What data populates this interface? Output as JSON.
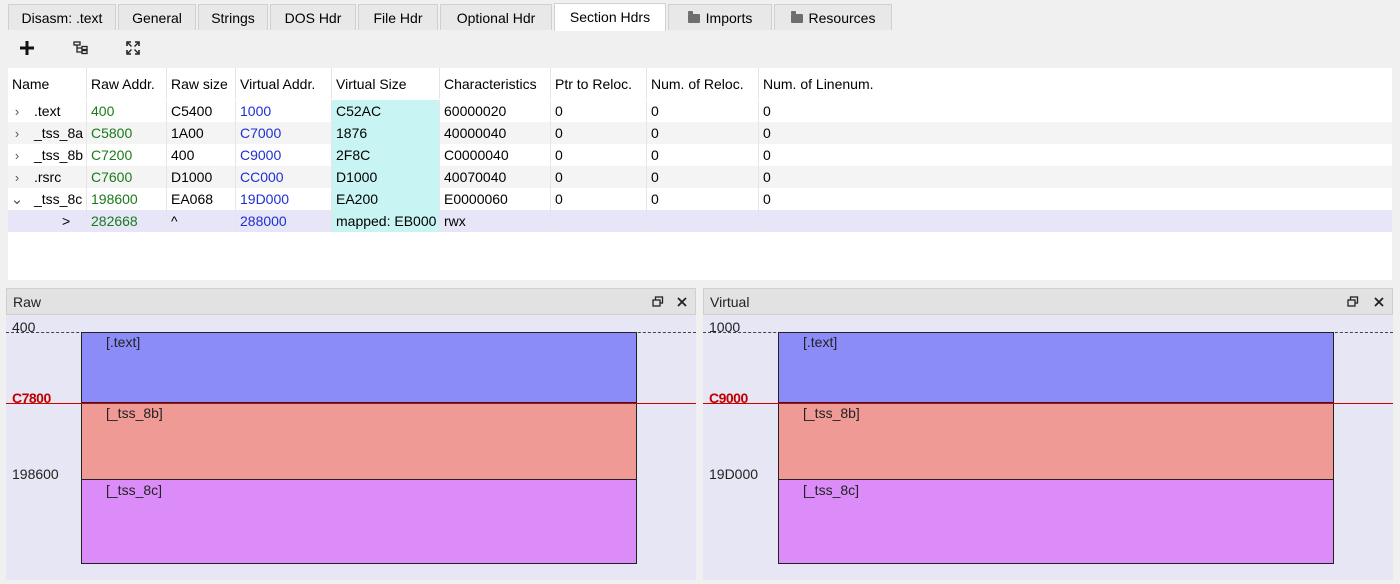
{
  "tabs": [
    {
      "label": "Disasm: .text"
    },
    {
      "label": "General"
    },
    {
      "label": "Strings"
    },
    {
      "label": "DOS Hdr"
    },
    {
      "label": "File Hdr"
    },
    {
      "label": "Optional Hdr"
    },
    {
      "label": "Section Hdrs",
      "active": true
    },
    {
      "label": "Imports",
      "icon": "folder-icon"
    },
    {
      "label": "Resources",
      "icon": "folder-icon"
    }
  ],
  "toolbar": {
    "add_icon": "plus-icon",
    "tree_icon": "tree-view-icon",
    "expand_icon": "fit-view-icon"
  },
  "table": {
    "columns": [
      "Name",
      "Raw Addr.",
      "Raw size",
      "Virtual Addr.",
      "Virtual Size",
      "Characteristics",
      "Ptr to Reloc.",
      "Num. of Reloc.",
      "Num. of Linenum."
    ],
    "rows": [
      {
        "arrow": "›",
        "name": ".text",
        "raw_addr": "400",
        "raw_size": "C5400",
        "virt_addr": "1000",
        "virt_size": "C52AC",
        "chars": "60000020",
        "ptr_reloc": "0",
        "num_reloc": "0",
        "num_line": "0"
      },
      {
        "arrow": "›",
        "name": "_tss_8a",
        "raw_addr": "C5800",
        "raw_size": "1A00",
        "virt_addr": "C7000",
        "virt_size": "1876",
        "chars": "40000040",
        "ptr_reloc": "0",
        "num_reloc": "0",
        "num_line": "0"
      },
      {
        "arrow": "›",
        "name": "_tss_8b",
        "raw_addr": "C7200",
        "raw_size": "400",
        "virt_addr": "C9000",
        "virt_size": "2F8C",
        "chars": "C0000040",
        "ptr_reloc": "0",
        "num_reloc": "0",
        "num_line": "0"
      },
      {
        "arrow": "›",
        "name": ".rsrc",
        "raw_addr": "C7600",
        "raw_size": "D1000",
        "virt_addr": "CC000",
        "virt_size": "D1000",
        "chars": "40070040",
        "ptr_reloc": "0",
        "num_reloc": "0",
        "num_line": "0"
      },
      {
        "arrow": "⌄",
        "name": "_tss_8c",
        "raw_addr": "198600",
        "raw_size": "EA068",
        "virt_addr": "19D000",
        "virt_size": "EA200",
        "chars": "E0000060",
        "ptr_reloc": "0",
        "num_reloc": "0",
        "num_line": "0"
      }
    ],
    "subrow": {
      "marker": ">",
      "raw_addr": "282668",
      "raw_size": "^",
      "virt_addr": "288000",
      "virt_size": "mapped: EB000",
      "chars": "rwx"
    }
  },
  "raw_panel": {
    "title": "Raw",
    "top_addr": "400",
    "mid_addr": "C7800",
    "low_addr": "198600",
    "blocks": [
      {
        "label": "[.text]",
        "color": "#8c8cf8"
      },
      {
        "label": "[_tss_8b]",
        "color": "#f09a96"
      },
      {
        "label": "[_tss_8c]",
        "color": "#dc8cf8"
      }
    ]
  },
  "virtual_panel": {
    "title": "Virtual",
    "top_addr": "1000",
    "mid_addr": "C9000",
    "low_addr": "19D000",
    "blocks": [
      {
        "label": "[.text]",
        "color": "#8c8cf8"
      },
      {
        "label": "[_tss_8b]",
        "color": "#f09a96"
      },
      {
        "label": "[_tss_8c]",
        "color": "#dc8cf8"
      }
    ]
  },
  "colors": {
    "raw_addr": "#1a7a1a",
    "virt_addr": "#1f2fd1",
    "virt_size_bg": "#c8f4f4",
    "marker_line": "#d00000"
  }
}
